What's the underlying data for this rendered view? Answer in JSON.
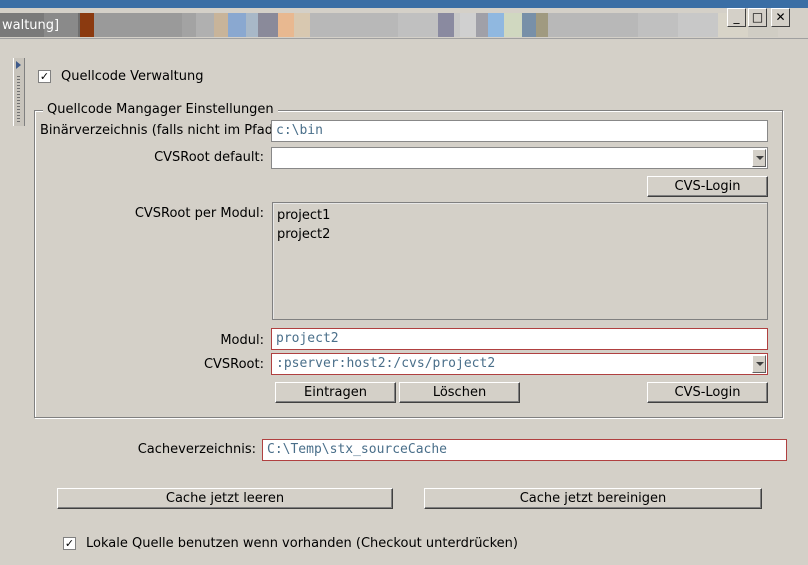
{
  "window": {
    "title_fragment": "waltung]",
    "title_colors": [
      "#7a7a7a",
      "#8a8a8a",
      "#6f6f6f",
      "#8b3a10",
      "#9a9a9a",
      "#a3a3a3",
      "#b0b0b0",
      "#c8b49a",
      "#8aa8d0",
      "#a8b8c8",
      "#8a8a9a",
      "#e8b890",
      "#d8c8b0",
      "#b8b8b8",
      "#c0c0c0",
      "#8a8aa0",
      "#c8c8c8",
      "#d0d0d0",
      "#a0a0a8",
      "#90b8e0",
      "#d0d8c0",
      "#7890a8",
      "#a09a80",
      "#b8b8b8",
      "#c0c0c0",
      "#c8c8c8",
      "#d8d4c8",
      "#d0cdc4"
    ],
    "minimize_glyph": "_",
    "maximize_glyph": "□",
    "close_glyph": "✕"
  },
  "source_control": {
    "enabled_label": "Quellcode Verwaltung",
    "enabled_checked": true,
    "check_glyph": "✓"
  },
  "manager": {
    "group_title": "Quellcode Mangager Einstellungen",
    "bin_dir_label": "Binärverzeichnis (falls nicht im Pfad):",
    "bin_dir_value": "c:\\bin",
    "cvsroot_default_label": "CVSRoot default:",
    "cvsroot_default_value": "",
    "cvs_login_label": "CVS-Login",
    "cvsroot_per_module_label": "CVSRoot per Modul:",
    "modules": [
      "project1",
      "project2"
    ],
    "module_label": "Modul:",
    "module_value": "project2",
    "cvsroot_label": "CVSRoot:",
    "cvsroot_value": ":pserver:host2:/cvs/project2",
    "add_label": "Eintragen",
    "delete_label": "Löschen",
    "cvs_login2_label": "CVS-Login"
  },
  "cache": {
    "dir_label": "Cacheverzeichnis:",
    "dir_value": "C:\\Temp\\stx_sourceCache",
    "clear_label": "Cache jetzt leeren",
    "cleanup_label": "Cache jetzt bereinigen",
    "local_source_label": "Lokale Quelle benutzen wenn vorhanden (Checkout unterdrücken)",
    "local_source_checked": true
  }
}
